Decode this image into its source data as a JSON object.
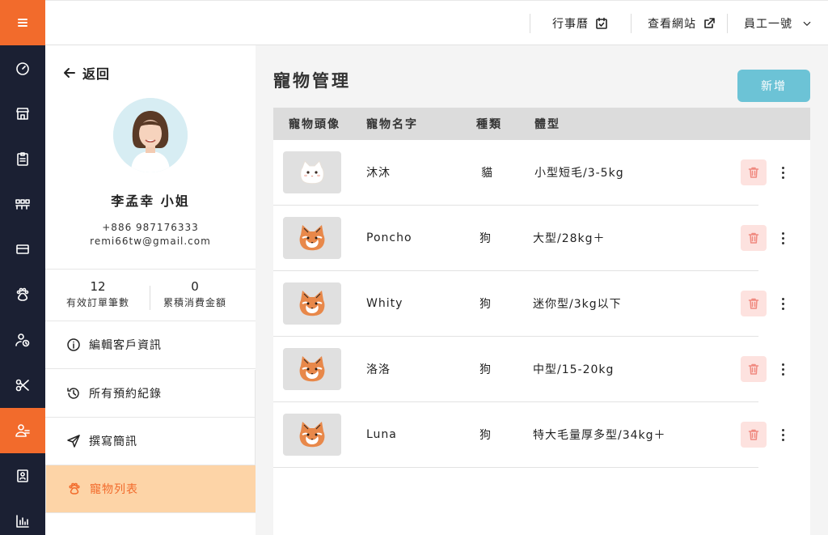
{
  "header": {
    "calendar_label": "行事曆",
    "view_site_label": "查看網站",
    "user_label": "員工一號"
  },
  "rail": {
    "icons": [
      "menu-icon",
      "dashboard-icon",
      "store-icon",
      "clipboard-icon",
      "seats-icon",
      "ticket-icon",
      "paw-icon",
      "user-clock-icon",
      "scissors-icon",
      "customers-icon",
      "contact-icon",
      "chart-icon"
    ],
    "active": "customers-icon"
  },
  "sidebar": {
    "back_label": "返回",
    "customer_name": "李孟幸 小姐",
    "phone": "+886 987176333",
    "email": "remi66tw@gmail.com",
    "stats": [
      {
        "value": "12",
        "label": "有效訂單筆數"
      },
      {
        "value": "0",
        "label": "累積消費金額"
      }
    ],
    "menu": [
      {
        "label": "編輯客戶資訊",
        "icon": "info-icon"
      },
      {
        "label": "所有預約紀錄",
        "icon": "history-icon"
      },
      {
        "label": "撰寫簡訊",
        "icon": "send-icon"
      },
      {
        "label": "寵物列表",
        "icon": "paw-icon",
        "active": true
      }
    ]
  },
  "main": {
    "title": "寵物管理",
    "add_label": "新增",
    "columns": [
      "寵物頭像",
      "寵物名字",
      "種類",
      "體型"
    ],
    "rows": [
      {
        "avatar": "cat-avatar-icon",
        "name": "沐沐",
        "species": "貓",
        "size": "小型短毛/3-5kg"
      },
      {
        "avatar": "shiba-avatar-icon",
        "name": "Poncho",
        "species": "狗",
        "size": "大型/28kg＋"
      },
      {
        "avatar": "shiba-avatar-icon",
        "name": "Whity",
        "species": "狗",
        "size": "迷你型/3kg以下"
      },
      {
        "avatar": "shiba-avatar-icon",
        "name": "洛洛",
        "species": "狗",
        "size": "中型/15-20kg"
      },
      {
        "avatar": "shiba-avatar-icon",
        "name": "Luna",
        "species": "狗",
        "size": "特大毛量厚多型/34kg＋"
      }
    ]
  },
  "colors": {
    "accent": "#f26b2c",
    "rail": "#1b2033",
    "active_menu_bg": "#fdd4a7",
    "add_button": "#6cc3d6",
    "delete_bg": "#fde2df"
  }
}
